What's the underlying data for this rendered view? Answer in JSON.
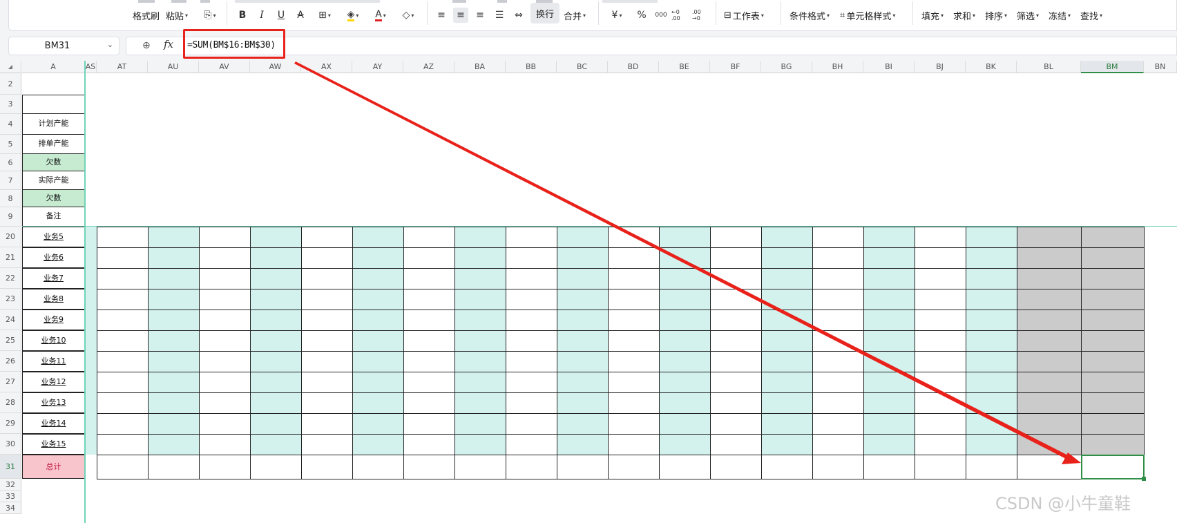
{
  "ribbon": {
    "format_painter": "格式刷",
    "paste": "粘贴",
    "bold": "B",
    "italic": "I",
    "underline": "U",
    "strike": "A",
    "font_color": "A",
    "wrap": "换行",
    "merge": "合并",
    "currency": "¥",
    "percent": "%",
    "thousands": "000",
    "inc_decimal": "←0 .00",
    "dec_decimal": ".00 →0",
    "worksheet": "工作表",
    "conditional_format": "条件格式",
    "cell_style": "单元格样式",
    "fill": "填充",
    "sum": "求和",
    "sort": "排序",
    "filter": "筛选",
    "freeze": "冻结",
    "find": "查找"
  },
  "formula_bar": {
    "name_box": "BM31",
    "fx": "fx",
    "formula": "=SUM(BM$16:BM$30)"
  },
  "columns": [
    "A",
    "AS",
    "AT",
    "AU",
    "AV",
    "AW",
    "AX",
    "AY",
    "AZ",
    "BA",
    "BB",
    "BC",
    "BD",
    "BE",
    "BF",
    "BG",
    "BH",
    "BI",
    "BJ",
    "BK",
    "BL",
    "BM",
    "BN"
  ],
  "active_column": "BM",
  "rows": [
    {
      "num": "2",
      "label": ""
    },
    {
      "num": "3",
      "label": ""
    },
    {
      "num": "4",
      "label": "计划产能"
    },
    {
      "num": "5",
      "label": "排单产能"
    },
    {
      "num": "6",
      "label": "欠数"
    },
    {
      "num": "7",
      "label": "实际产能"
    },
    {
      "num": "8",
      "label": "欠数"
    },
    {
      "num": "9",
      "label": "备注"
    },
    {
      "num": "20",
      "label": "业务5"
    },
    {
      "num": "21",
      "label": "业务6"
    },
    {
      "num": "22",
      "label": "业务7"
    },
    {
      "num": "23",
      "label": "业务8"
    },
    {
      "num": "24",
      "label": "业务9"
    },
    {
      "num": "25",
      "label": "业务10"
    },
    {
      "num": "26",
      "label": "业务11"
    },
    {
      "num": "27",
      "label": "业务12"
    },
    {
      "num": "28",
      "label": "业务13"
    },
    {
      "num": "29",
      "label": "业务14"
    },
    {
      "num": "30",
      "label": "业务15"
    },
    {
      "num": "31",
      "label": "总计"
    },
    {
      "num": "32",
      "label": ""
    },
    {
      "num": "33",
      "label": ""
    },
    {
      "num": "34",
      "label": ""
    }
  ],
  "active_row": "31",
  "colors": {
    "teal_fill": "#d3f2ee",
    "gray_fill": "#cbcbcb",
    "green_fill": "#c6ebd1",
    "pink_fill": "#f9c5cd",
    "selection": "#2f8f46",
    "annotation_red": "#e8221b"
  },
  "watermark": "CSDN @小牛童鞋"
}
